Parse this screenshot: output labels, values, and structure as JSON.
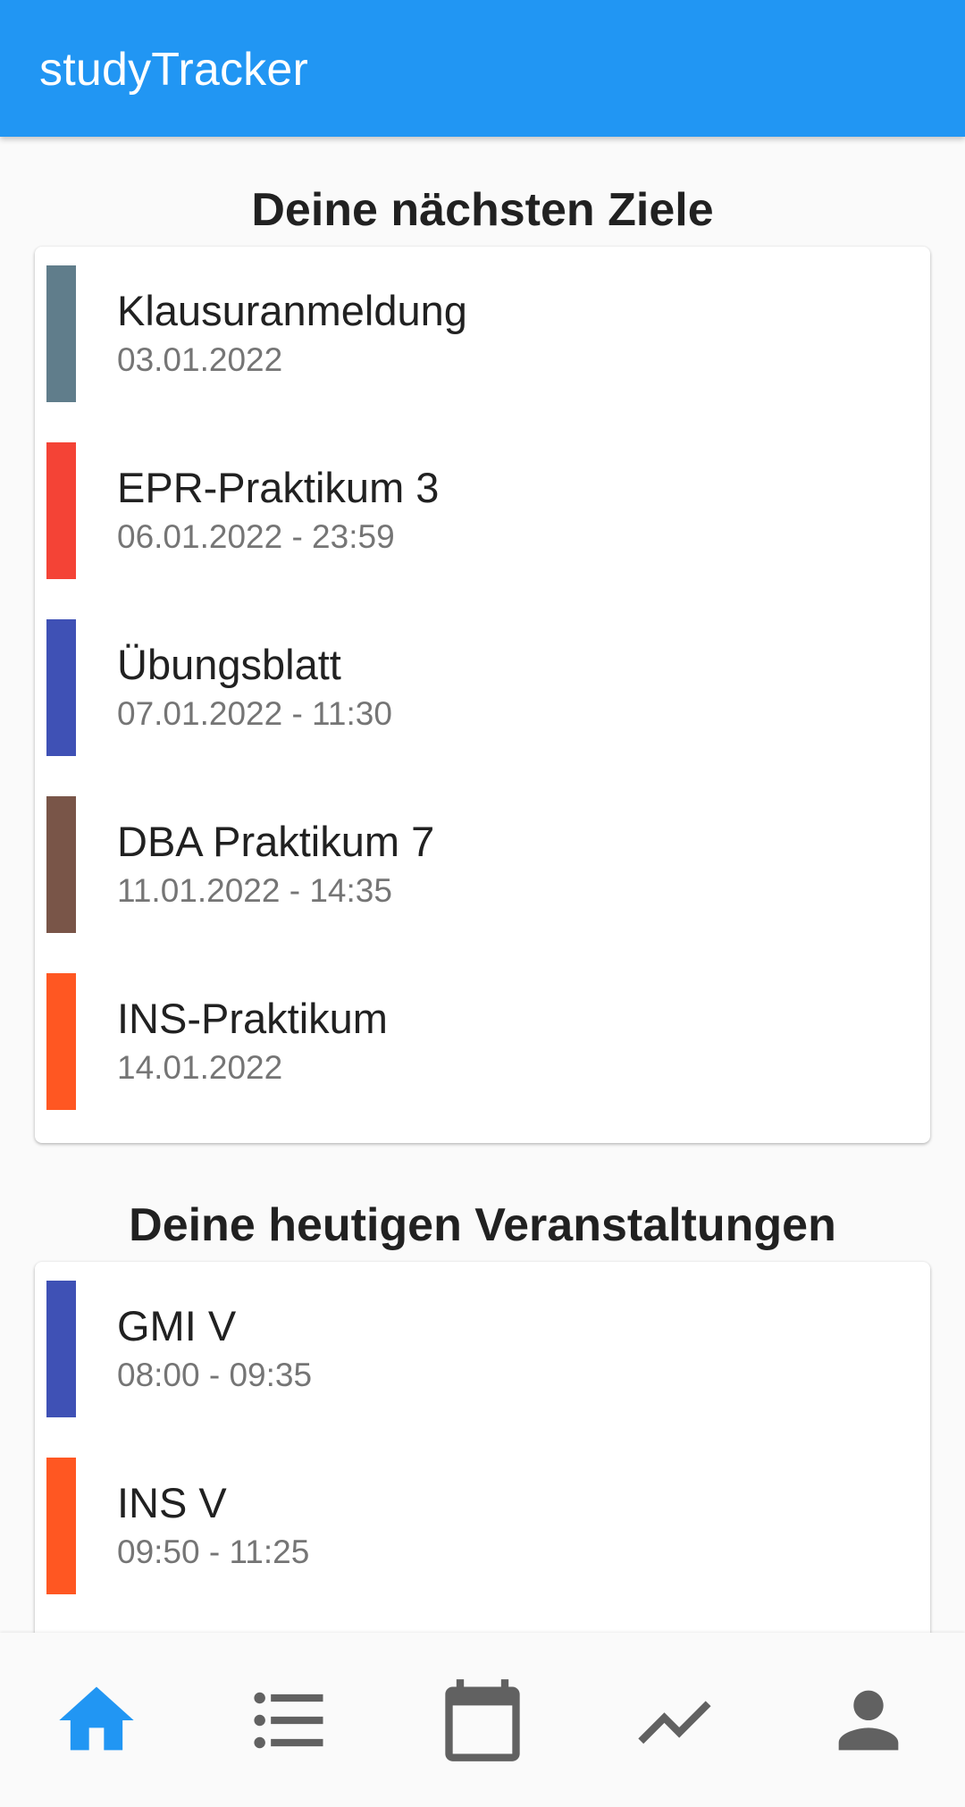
{
  "app": {
    "title": "studyTracker"
  },
  "colors": {
    "primary": "#2196f3",
    "navActive": "#2196f3",
    "navInactive": "#616161"
  },
  "goals": {
    "title": "Deine nächsten Ziele",
    "items": [
      {
        "name": "Klausuranmeldung",
        "date": "03.01.2022",
        "color": "#607d8b"
      },
      {
        "name": "EPR-Praktikum 3",
        "date": "06.01.2022 - 23:59",
        "color": "#f44336"
      },
      {
        "name": "Übungsblatt",
        "date": "07.01.2022 - 11:30",
        "color": "#3f51b5"
      },
      {
        "name": "DBA Praktikum 7",
        "date": "11.01.2022 - 14:35",
        "color": "#795548"
      },
      {
        "name": "INS-Praktikum",
        "date": "14.01.2022",
        "color": "#ff5722"
      }
    ]
  },
  "events": {
    "title": "Deine heutigen Veranstaltungen",
    "items": [
      {
        "name": "GMI V",
        "time": "08:00 - 09:35",
        "color": "#3f51b5"
      },
      {
        "name": "INS V",
        "time": "09:50 - 11:25",
        "color": "#ff5722"
      }
    ]
  },
  "bottomNav": {
    "items": [
      {
        "icon": "home-icon",
        "active": true
      },
      {
        "icon": "list-icon",
        "active": false
      },
      {
        "icon": "calendar-icon",
        "active": false
      },
      {
        "icon": "trending-icon",
        "active": false
      },
      {
        "icon": "person-icon",
        "active": false
      }
    ]
  }
}
